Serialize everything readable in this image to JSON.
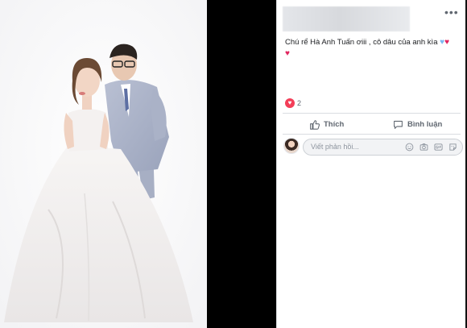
{
  "post": {
    "caption": "Chú rể Hà Anh Tuấn ơiii , cô dâu của anh kìa",
    "caption_emojis": [
      "blue-heart",
      "red-heart",
      "red-heart"
    ],
    "reaction_count": "2",
    "like_label": "Thích",
    "comment_label": "Bình luận",
    "comment_placeholder": "Viết phản hồi..."
  },
  "colors": {
    "accent_love": "#f33e58",
    "text_secondary": "#606770",
    "text_primary": "#1c1e21"
  }
}
